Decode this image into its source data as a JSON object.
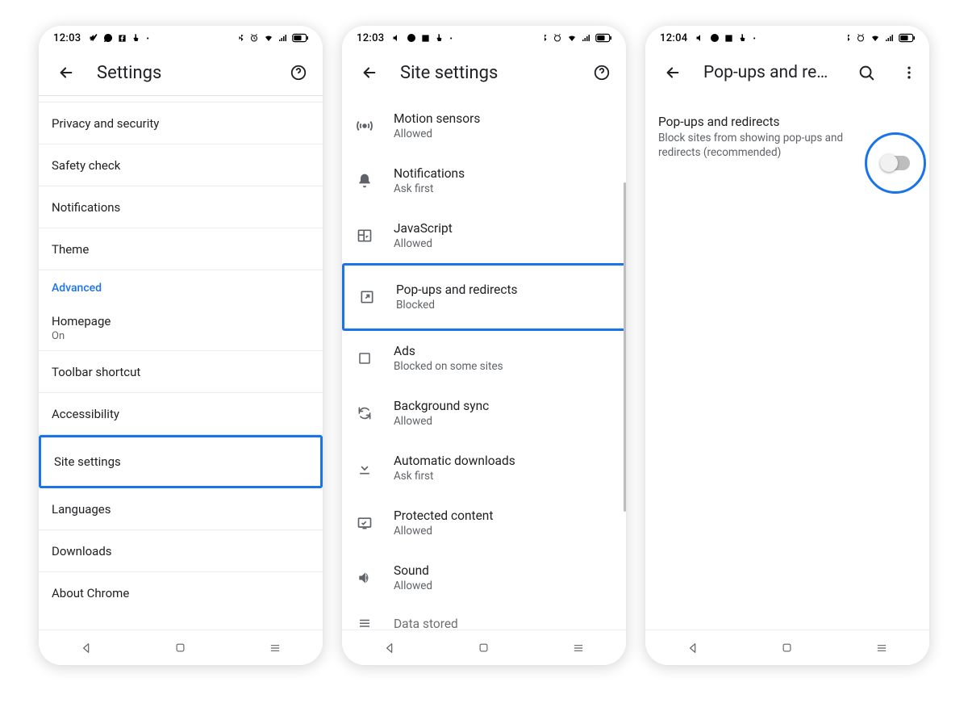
{
  "status": {
    "time1": "12:03",
    "time2": "12:03",
    "time3": "12:04"
  },
  "screen1": {
    "title": "Settings",
    "items": [
      {
        "label": "Privacy and security"
      },
      {
        "label": "Safety check"
      },
      {
        "label": "Notifications"
      },
      {
        "label": "Theme"
      }
    ],
    "advanced_header": "Advanced",
    "items2": [
      {
        "label": "Homepage",
        "sub": "On"
      },
      {
        "label": "Toolbar shortcut"
      },
      {
        "label": "Accessibility"
      },
      {
        "label": "Site settings"
      },
      {
        "label": "Languages"
      },
      {
        "label": "Downloads"
      },
      {
        "label": "About Chrome"
      }
    ]
  },
  "screen2": {
    "title": "Site settings",
    "items": [
      {
        "label": "Motion sensors",
        "sub": "Allowed",
        "icon": "sensors"
      },
      {
        "label": "Notifications",
        "sub": "Ask first",
        "icon": "bell"
      },
      {
        "label": "JavaScript",
        "sub": "Allowed",
        "icon": "js"
      },
      {
        "label": "Pop-ups and redirects",
        "sub": "Blocked",
        "icon": "popup"
      },
      {
        "label": "Ads",
        "sub": "Blocked on some sites",
        "icon": "ads"
      },
      {
        "label": "Background sync",
        "sub": "Allowed",
        "icon": "sync"
      },
      {
        "label": "Automatic downloads",
        "sub": "Ask first",
        "icon": "download"
      },
      {
        "label": "Protected content",
        "sub": "Allowed",
        "icon": "protected"
      },
      {
        "label": "Sound",
        "sub": "Allowed",
        "icon": "sound"
      },
      {
        "label": "Data stored",
        "sub": "",
        "icon": "data"
      }
    ]
  },
  "screen3": {
    "title": "Pop-ups and redir...",
    "row_title": "Pop-ups and redirects",
    "row_desc": "Block sites from showing pop-ups and redirects (recommended)",
    "toggle_on": false
  }
}
